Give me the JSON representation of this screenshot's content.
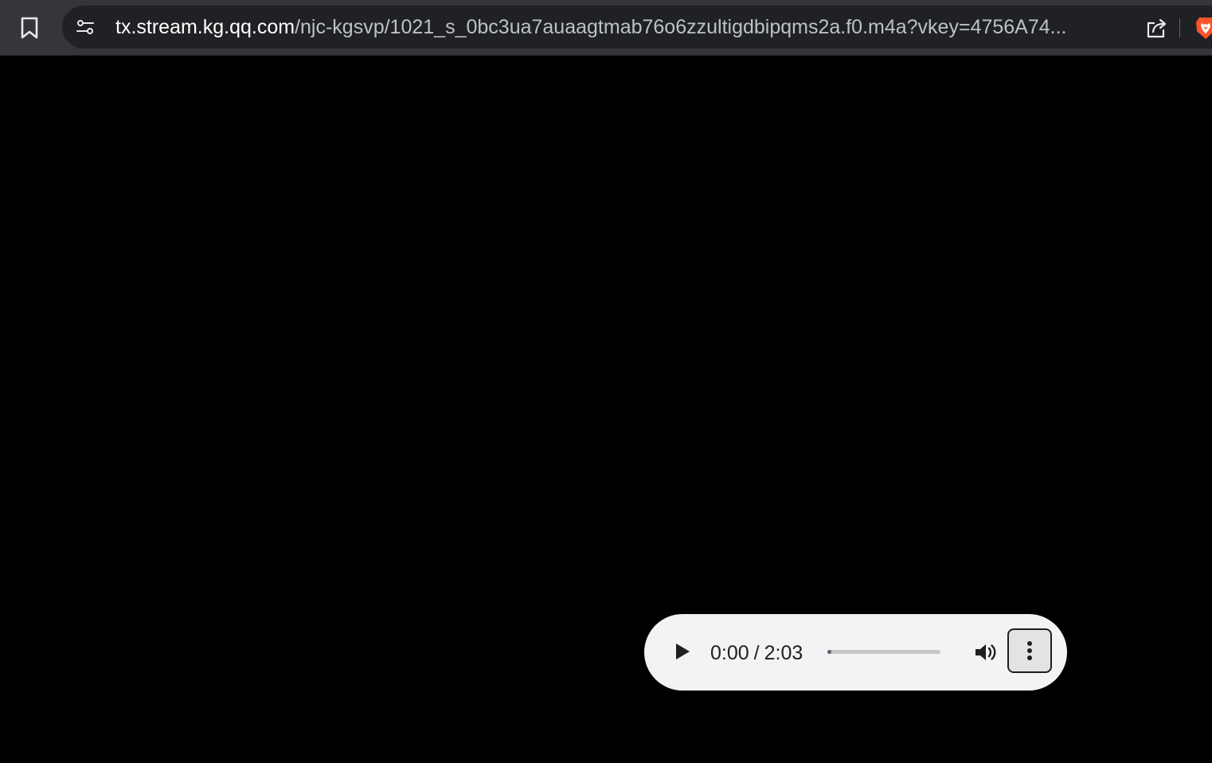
{
  "browser": {
    "url": {
      "host": "tx.stream.kg.qq.com",
      "path": "/njc-kgsvp/1021_s_0bc3ua7auaagtmab76o6zzultigdbipqms2a.f0.m4a?vkey=4756A74..."
    },
    "colors": {
      "toolbar": "#35363a",
      "omnibox": "#202124",
      "brave_orange": "#fb542b"
    },
    "icons": {
      "bookmark": "bookmark-icon",
      "site_info": "tune-icon",
      "share": "share-icon",
      "brave_shields": "brave-lion-icon"
    }
  },
  "player": {
    "current_time": "0:00",
    "separator": "/",
    "duration": "2:03",
    "progress": 0.0,
    "colors": {
      "background": "#f1f3f4",
      "text": "#1f1f1f"
    },
    "icons": {
      "play": "play-icon",
      "volume": "volume-icon",
      "menu": "more-vertical-icon"
    }
  }
}
